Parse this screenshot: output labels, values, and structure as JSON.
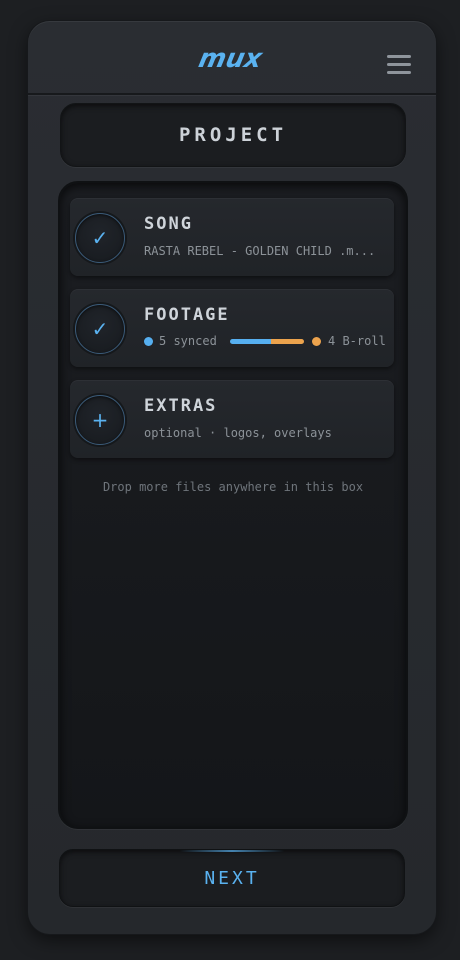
{
  "app": {
    "logo_text": "mux",
    "accent_color": "#5ab2f0",
    "broll_color": "#eca34d"
  },
  "header": {
    "menu_icon": "hamburger-menu-icon"
  },
  "project": {
    "title": "PROJECT"
  },
  "items": {
    "song": {
      "title": "SONG",
      "status_icon": "check-icon",
      "check": "✓",
      "subtitle": "RASTA REBEL - GOLDEN CHILD .m..."
    },
    "footage": {
      "title": "FOOTAGE",
      "status_icon": "check-icon",
      "check": "✓",
      "synced_label": "5 synced",
      "broll_label": "4 B-roll",
      "synced_count": 5,
      "broll_count": 4
    },
    "extras": {
      "title": "EXTRAS",
      "status_icon": "plus-icon",
      "plus": "+",
      "subtitle": "optional · logos, overlays"
    }
  },
  "drop_hint": "Drop more files anywhere in this box",
  "next_label": "NEXT"
}
